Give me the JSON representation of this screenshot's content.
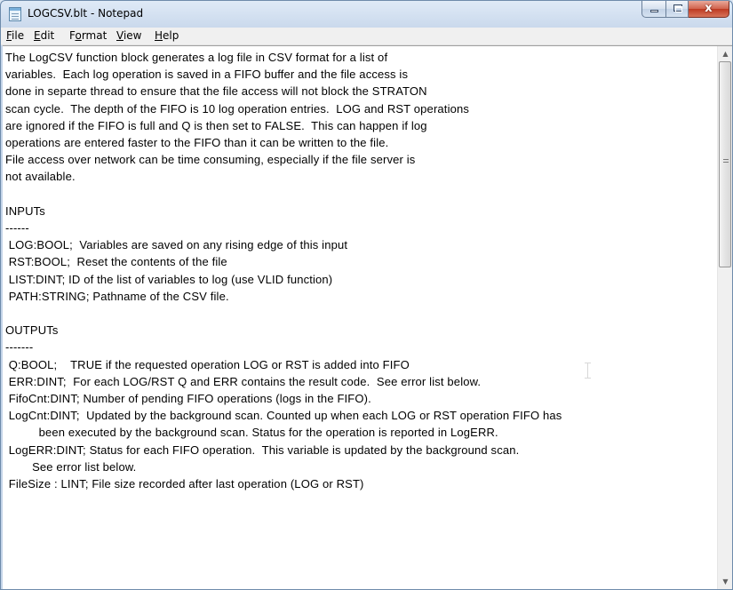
{
  "window": {
    "title": "LOGCSV.blt - Notepad",
    "icon": "notepad-icon"
  },
  "caption_buttons": {
    "minimize": "minimize-icon",
    "maximize": "maximize-icon",
    "close": "close-icon",
    "close_glyph": "x"
  },
  "menu": {
    "items": [
      {
        "underline": "F",
        "rest": "ile"
      },
      {
        "underline": "E",
        "rest": "dit"
      },
      {
        "pre": "F",
        "underline": "o",
        "rest": "rmat"
      },
      {
        "underline": "V",
        "rest": "iew"
      },
      {
        "underline": "H",
        "rest": "elp"
      }
    ]
  },
  "document": {
    "lines": [
      "The LogCSV function block generates a log file in CSV format for a list of",
      "variables.  Each log operation is saved in a FIFO buffer and the file access is",
      "done in separte thread to ensure that the file access will not block the STRATON",
      "scan cycle.  The depth of the FIFO is 10 log operation entries.  LOG and RST operations",
      "are ignored if the FIFO is full and Q is then set to FALSE.  This can happen if log",
      "operations are entered faster to the FIFO than it can be written to the file.",
      "File access over network can be time consuming, especially if the file server is",
      "not available.",
      "",
      "INPUTs",
      "------",
      " LOG:BOOL;  Variables are saved on any rising edge of this input",
      " RST:BOOL;  Reset the contents of the file",
      " LIST:DINT; ID of the list of variables to log (use VLID function)",
      " PATH:STRING; Pathname of the CSV file.",
      "",
      "OUTPUTs",
      "-------",
      " Q:BOOL;    TRUE if the requested operation LOG or RST is added into FIFO",
      " ERR:DINT;  For each LOG/RST Q and ERR contains the result code.  See error list below.",
      " FifoCnt:DINT; Number of pending FIFO operations (logs in the FIFO).",
      " LogCnt:DINT;  Updated by the background scan. Counted up when each LOG or RST operation FIFO has",
      "          been executed by the background scan. Status for the operation is reported in LogERR.",
      " LogERR:DINT; Status for each FIFO operation.  This variable is updated by the background scan.",
      "        See error list below.",
      " FileSize : LINT; File size recorded after last operation (LOG or RST)"
    ]
  },
  "scrollbar": {
    "up_glyph": "▲",
    "down_glyph": "▼",
    "position_fraction": 0
  }
}
